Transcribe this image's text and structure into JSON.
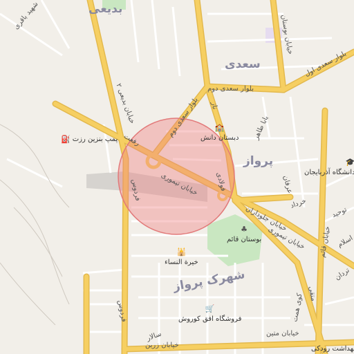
{
  "map": {
    "circle_color": "#f08080",
    "road_major_color": "#f6cf62",
    "road_minor_color": "#ffffff",
    "park_color": "#c9e7c1",
    "districts": {
      "badiei": "بدیعی",
      "saadi": "سعدی",
      "parvaz": "پرواز",
      "shahrak_parvaz": "شهرک پرواز"
    },
    "streets": {
      "shahid_baghari": "شهید باقری",
      "khiaban_bostan": "خیابان بوستان",
      "badiei_2": "خیابان بدیعی ۲",
      "saadi_aval": "بلوار سعدی اول",
      "saadi_dovom": "بلوار سعدی دوم",
      "saadi_dovom_b": "بلوار سعدی دوم",
      "naz": "ناز",
      "teymouri": "خیابان تیموری",
      "teymouri_b": "خیابان تیموری",
      "jelodaran": "خیابان جلوداران",
      "rafat": "رفعت",
      "fouladi": "فولادی",
      "baba_taher": "بابا طاهر",
      "khordad": "خرداد",
      "erfan": "عرفان",
      "tohid": "توحید",
      "ghaem": "خیابان قائم",
      "eslam": "اسلام",
      "mottaki": "متقی",
      "koy_hemat": "کوی همت",
      "fardous": "فردوس",
      "khiaban_zarrin": "خیابان زرین",
      "salar": "سالار",
      "matin": "خیابان متین",
      "terdan": "تردان"
    },
    "pois": {
      "gas_station": "پمپ بنزین رزت",
      "school": "دبستان دانش",
      "park": "بوستان قائم",
      "khaira": "خیرة النساء",
      "store": "فروشگاه افق کوروش",
      "univ": "دانشگاه آذربایجان",
      "health": "خانه بهداشت رودکی"
    },
    "icons": {
      "gas": "fuel-icon",
      "school": "school-icon",
      "park": "tree-icon",
      "mosque": "mosque-icon",
      "store": "shopping-cart-icon",
      "univ": "graduation-icon",
      "health": "cross-icon"
    }
  }
}
